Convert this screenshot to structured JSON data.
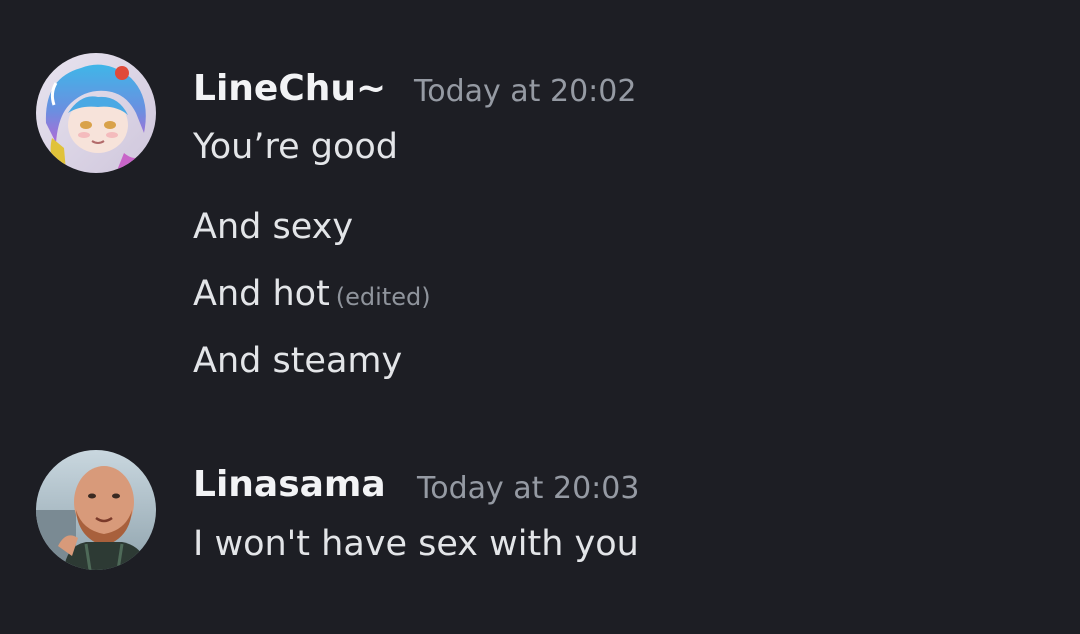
{
  "messages": [
    {
      "author": "LineChu~",
      "timestamp": "Today at 20:02",
      "avatar_icon": "anime-character-avatar",
      "lines": [
        {
          "text": "You’re good"
        },
        {
          "text": "And sexy"
        },
        {
          "text": "And hot",
          "edited": "(edited)"
        },
        {
          "text": "And steamy"
        }
      ]
    },
    {
      "author": "Linasama",
      "timestamp": "Today at 20:03",
      "avatar_icon": "user-photo-avatar",
      "lines": [
        {
          "text": "I won't have sex with you"
        }
      ]
    }
  ],
  "colors": {
    "background": "#1d1e24",
    "username": "#f2f3f5",
    "timestamp": "#959aa3",
    "message_text": "#e3e5e8"
  }
}
